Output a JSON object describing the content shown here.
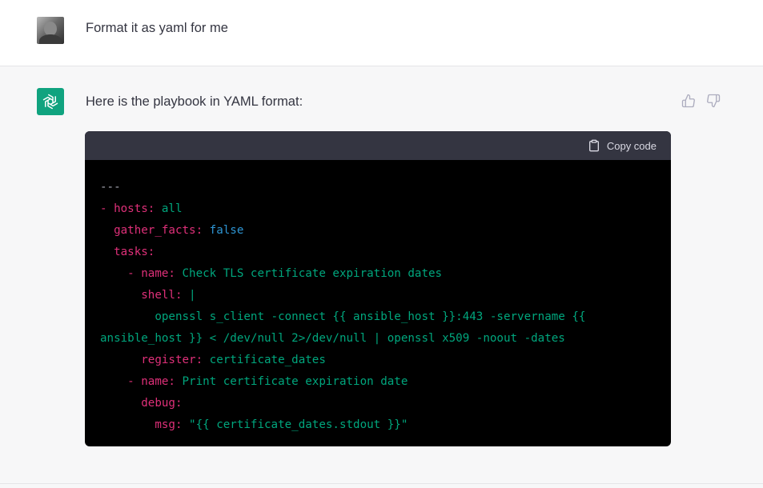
{
  "user": {
    "message": "Format it as yaml for me"
  },
  "assistant": {
    "message": "Here is the playbook in YAML format:",
    "code_block": {
      "copy_label": "Copy code",
      "lines": [
        [
          {
            "t": "---",
            "c": "c"
          }
        ],
        [
          {
            "t": "- hosts:",
            "c": "k"
          },
          {
            "t": " all",
            "c": "s"
          }
        ],
        [
          {
            "t": "  gather_facts:",
            "c": "k"
          },
          {
            "t": " false",
            "c": "b"
          }
        ],
        [
          {
            "t": "  tasks:",
            "c": "k"
          }
        ],
        [
          {
            "t": "    - name:",
            "c": "k"
          },
          {
            "t": " Check TLS certificate expiration dates",
            "c": "s"
          }
        ],
        [
          {
            "t": "      shell:",
            "c": "k"
          },
          {
            "t": " |",
            "c": "s"
          }
        ],
        [
          {
            "t": "        openssl s_client -connect {{ ansible_host }}:443 -servername {{",
            "c": "s"
          }
        ],
        [
          {
            "t": "ansible_host }} < /dev/null 2>/dev/null | openssl x509 -noout -dates",
            "c": "s"
          }
        ],
        [
          {
            "t": "      register:",
            "c": "k"
          },
          {
            "t": " certificate_dates",
            "c": "s"
          }
        ],
        [
          {
            "t": "    - name:",
            "c": "k"
          },
          {
            "t": " Print certificate expiration date",
            "c": "s"
          }
        ],
        [
          {
            "t": "      debug:",
            "c": "k"
          }
        ],
        [
          {
            "t": "        msg:",
            "c": "k"
          },
          {
            "t": " \"{{ certificate_dates.stdout }}\"",
            "c": "s"
          }
        ]
      ]
    }
  },
  "colors": {
    "brand": "#10a37f",
    "key": "#df3079",
    "string": "#00a67d",
    "boolean": "#2e95d3",
    "code_header": "#343541"
  },
  "icons": {
    "user_avatar": "user-avatar",
    "assistant_avatar": "openai-logo-icon",
    "copy": "clipboard-icon",
    "like": "thumbs-up-icon",
    "dislike": "thumbs-down-icon"
  }
}
